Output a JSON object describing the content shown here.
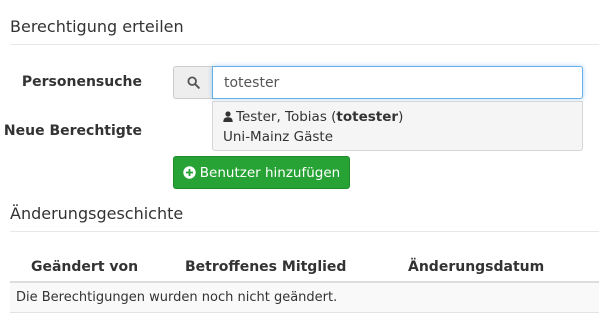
{
  "grant": {
    "title": "Berechtigung erteilen",
    "search_label": "Personensuche",
    "search_value": "totester",
    "new_label": "Neue Berechtigte",
    "suggestion": {
      "name_prefix": "Tester, Tobias (",
      "username": "totester",
      "name_suffix": ")",
      "group": "Uni-Mainz Gäste"
    },
    "add_button_label": "Benutzer hinzufügen"
  },
  "history": {
    "title": "Änderungsgeschichte",
    "columns": [
      "Geändert von",
      "Betroffenes Mitglied",
      "Änderungsdatum"
    ],
    "empty_message": "Die Berechtigungen wurden noch nicht geändert."
  },
  "colors": {
    "accent_focus": "#66afe9",
    "success_button": "#27a234"
  },
  "icons": {
    "search": "search-icon",
    "person": "user-icon",
    "add": "plus-circle-icon"
  }
}
